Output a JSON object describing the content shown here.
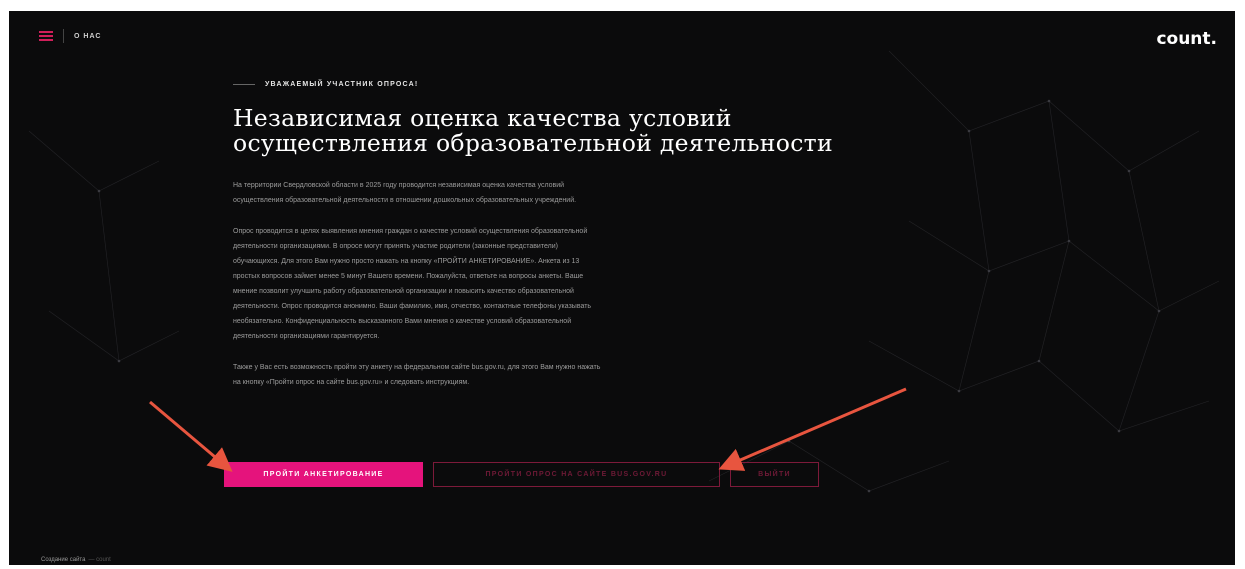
{
  "header": {
    "about_label": "О НАС",
    "logo_text": "count."
  },
  "hero": {
    "eyebrow": "УВАЖАЕМЫЙ УЧАСТНИК ОПРОСА!",
    "title_line1": "Независимая оценка качества условий",
    "title_line2": "осуществления образовательной деятельности",
    "paragraph1_line1": "На территории Свердловской области в 2025 году проводится независимая оценка качества условий",
    "paragraph1_line2": "осуществления образовательной деятельности в отношении дошкольных образовательных учреждений.",
    "paragraph2_lines": [
      "Опрос проводится в целях выявления мнения граждан о качестве условий осуществления образовательной",
      "деятельности организациями. В опросе могут принять участие родители (законные представители)",
      "обучающихся. Для этого Вам нужно просто нажать на кнопку «ПРОЙТИ АНКЕТИРОВАНИЕ». Анкета из 13",
      "простых вопросов займет менее 5 минут Вашего времени. Пожалуйста, ответьте на вопросы анкеты. Ваше",
      "мнение позволит улучшить работу образовательной организации и повысить качество образовательной",
      "деятельности. Опрос проводится анонимно. Ваши фамилию, имя, отчество, контактные телефоны указывать",
      "необязательно. Конфиденциальность высказанного Вами мнения о качестве условий образовательной",
      "деятельности организациями гарантируется."
    ],
    "paragraph3_line1": "Также у Вас есть возможность пройти эту анкету на федеральном сайте bus.gov.ru, для этого Вам нужно нажать",
    "paragraph3_line2": "на кнопку «Пройти опрос на сайте bus.gov.ru» и следовать инструкциям."
  },
  "buttons": {
    "primary_label": "ПРОЙТИ АНКЕТИРОВАНИЕ",
    "bus_label": "ПРОЙТИ ОПРОС НА САЙТЕ BUS.GOV.RU",
    "exit_label": "ВЫЙТИ"
  },
  "footer": {
    "dev_label": "Создание сайта",
    "dev_brand": "— count"
  },
  "colors": {
    "background": "#0b0b0c",
    "accent": "#e5137c",
    "outline": "#7d1a3a",
    "annotation_arrow": "#e8553f"
  }
}
